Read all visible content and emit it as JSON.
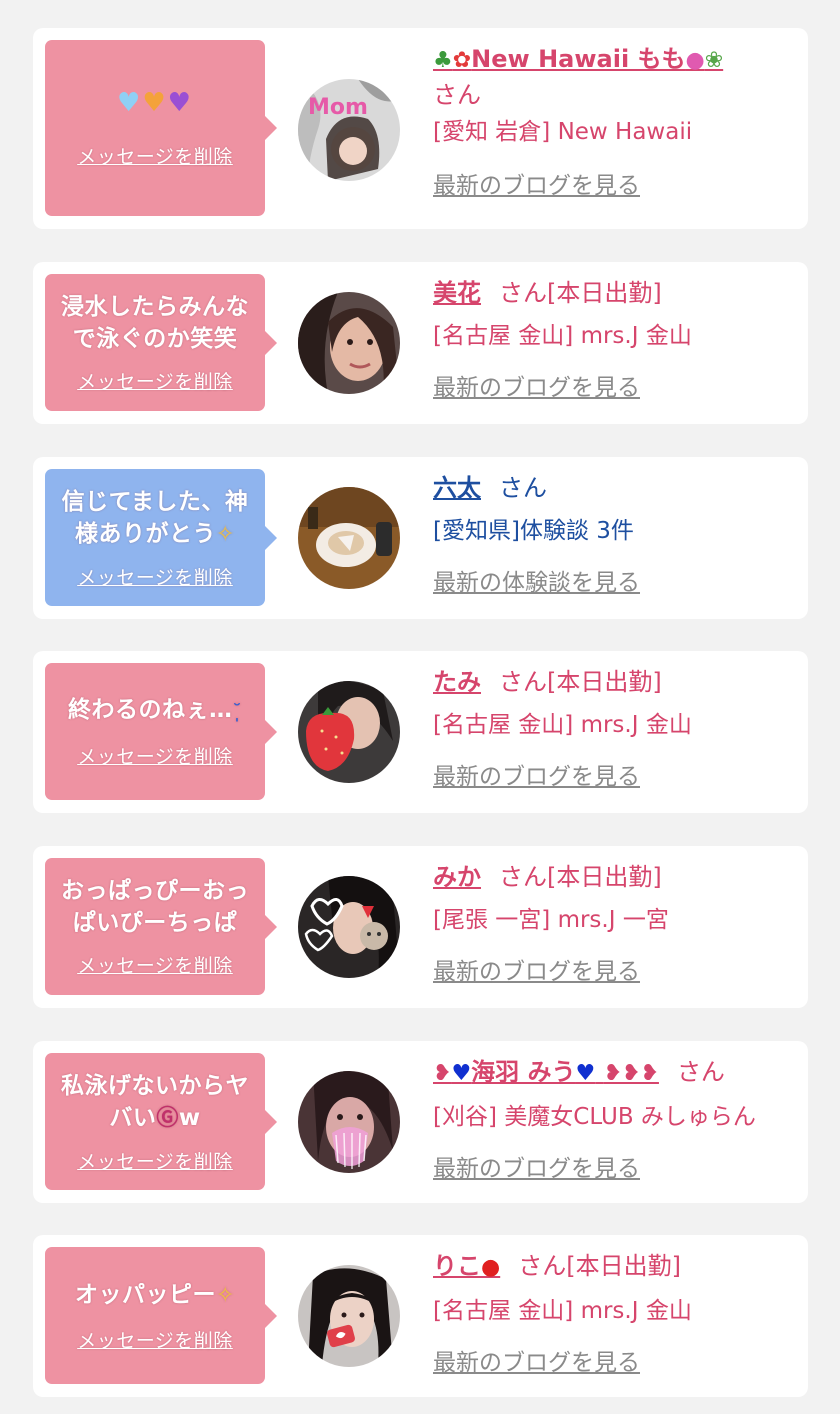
{
  "cards": [
    {
      "name": "New Hawaii もも",
      "suffix": "さん",
      "shop": "[愛知 岩倉] New Hawaii",
      "link": "最新のブログを見る",
      "message": "",
      "delete": "メッセージを削除"
    },
    {
      "name": "美花",
      "suffix": "さん[本日出勤]",
      "shop": "[名古屋 金山] mrs.J 金山",
      "link": "最新のブログを見る",
      "message": "浸水したらみんなで泳ぐのか笑笑",
      "delete": "メッセージを削除"
    },
    {
      "name": "六太",
      "suffix": "さん",
      "shop": "[愛知県]体験談 3件",
      "link": "最新の体験談を見る",
      "message": "信じてました、神様ありがとう",
      "delete": "メッセージを削除"
    },
    {
      "name": "たみ",
      "suffix": "さん[本日出勤]",
      "shop": "[名古屋 金山] mrs.J 金山",
      "link": "最新のブログを見る",
      "message": "終わるのねぇ…",
      "delete": "メッセージを削除"
    },
    {
      "name": "みか",
      "suffix": "さん[本日出勤]",
      "shop": "[尾張 一宮] mrs.J 一宮",
      "link": "最新のブログを見る",
      "message": "おっぱっぴーおっぱいぴーちっぱ",
      "delete": "メッセージを削除"
    },
    {
      "name": "海羽 みう",
      "suffix": "さん",
      "shop": "[刈谷] 美魔女CLUB みしゅらん",
      "link": "最新のブログを見る",
      "message": "私泳げないからヤバい",
      "message_tail": "w",
      "delete": "メッセージを削除"
    },
    {
      "name": "りこ",
      "suffix": "さん[本日出勤]",
      "shop": "[名古屋 金山] mrs.J 金山",
      "link": "最新のブログを見る",
      "message": "オッパッピー",
      "delete": "メッセージを削除"
    }
  ]
}
